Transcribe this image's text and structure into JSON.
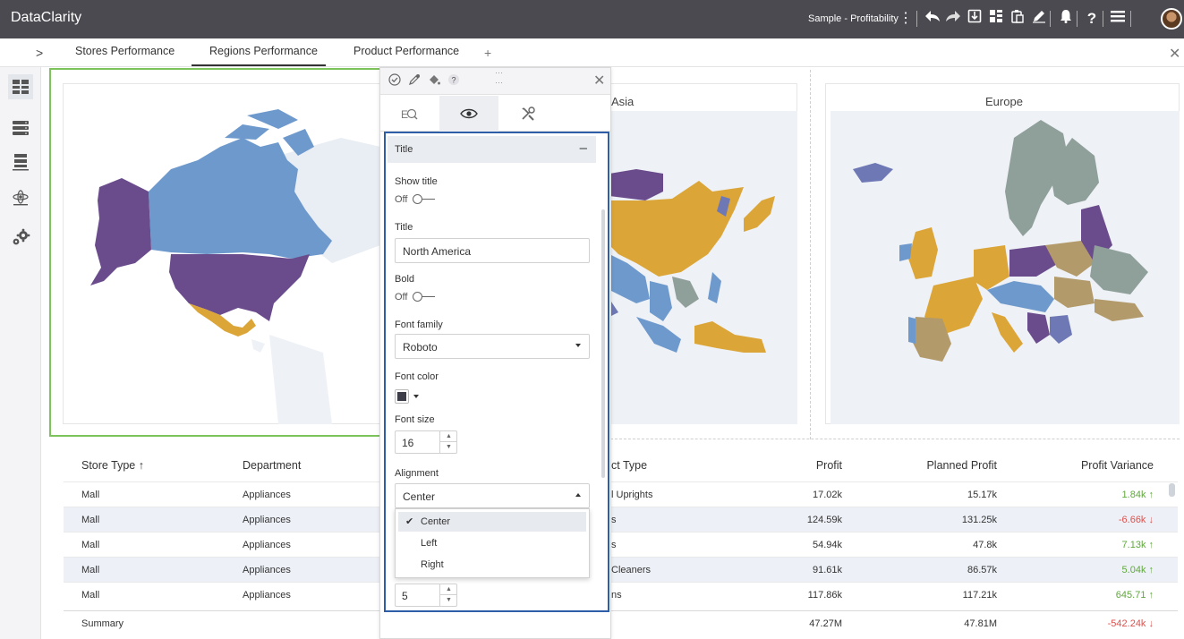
{
  "app": {
    "name": "DataClarity",
    "profile": "Sample - Profitability"
  },
  "toolbar_icons": [
    "more-vertical-icon",
    "undo-icon",
    "redo-icon",
    "save-icon",
    "layout-icon",
    "paste-icon",
    "edit-icon",
    "bell-icon",
    "help-icon",
    "menu-icon",
    "avatar"
  ],
  "tabs": {
    "items": [
      "Stores Performance",
      "Regions Performance",
      "Product Performance"
    ],
    "active": "Regions Performance",
    "add": "+",
    "expand": ">"
  },
  "maps": [
    {
      "title": "",
      "region": "North America"
    },
    {
      "title": "Asia",
      "region": "Asia"
    },
    {
      "title": "Europe",
      "region": "Europe"
    }
  ],
  "map_colors": {
    "purple": "#6a4c8c",
    "blue": "#6e99cc",
    "gold": "#dca537",
    "tan": "#b39a6a",
    "gray": "#8f9f99",
    "slate": "#6d78b5",
    "land_bg": "#e9edf4"
  },
  "table": {
    "headers": [
      "Store Type",
      "Department",
      "ct Type",
      "Profit",
      "Planned Profit",
      "Profit Variance"
    ],
    "sort_icon": "↑",
    "rows": [
      {
        "store": "Mall",
        "dept": "Appliances",
        "type": "l Uprights",
        "profit": "17.02k",
        "planned": "15.17k",
        "variance": "1.84k ↑",
        "dir": "up"
      },
      {
        "store": "Mall",
        "dept": "Appliances",
        "type": "s",
        "profit": "124.59k",
        "planned": "131.25k",
        "variance": "-6.66k ↓",
        "dir": "down"
      },
      {
        "store": "Mall",
        "dept": "Appliances",
        "type": "s",
        "profit": "54.94k",
        "planned": "47.8k",
        "variance": "7.13k ↑",
        "dir": "up"
      },
      {
        "store": "Mall",
        "dept": "Appliances",
        "type": "Cleaners",
        "profit": "91.61k",
        "planned": "86.57k",
        "variance": "5.04k ↑",
        "dir": "up"
      },
      {
        "store": "Mall",
        "dept": "Appliances",
        "type": "ns",
        "profit": "117.86k",
        "planned": "117.21k",
        "variance": "645.71 ↑",
        "dir": "up"
      }
    ],
    "summary": {
      "label": "Summary",
      "profit": "47.27M",
      "planned": "47.81M",
      "variance": "-542.24k ↓"
    }
  },
  "props": {
    "section_title": "Title",
    "section_toggle": "–",
    "show_title": {
      "label": "Show title",
      "state": "Off"
    },
    "title": {
      "label": "Title",
      "value": "North America"
    },
    "bold": {
      "label": "Bold",
      "state": "Off"
    },
    "font_family": {
      "label": "Font family",
      "value": "Roboto"
    },
    "font_color": {
      "label": "Font color",
      "value": "#3d3d48"
    },
    "font_size": {
      "label": "Font size",
      "value": "16"
    },
    "alignment": {
      "label": "Alignment",
      "value": "Center",
      "options": [
        "Center",
        "Left",
        "Right"
      ]
    },
    "next_value": "5"
  }
}
